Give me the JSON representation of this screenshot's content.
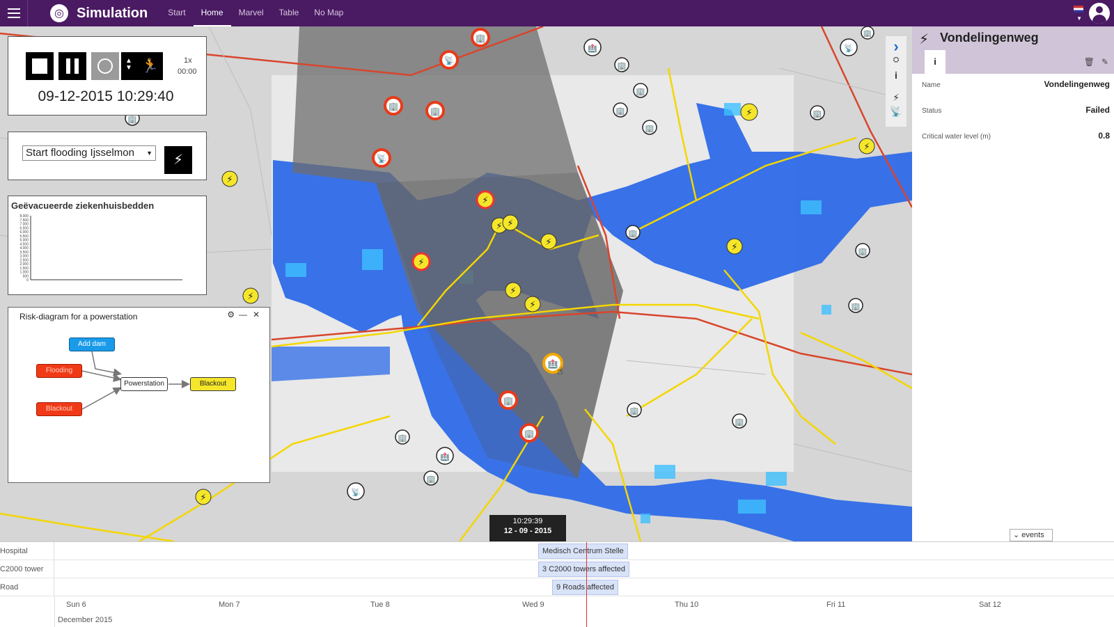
{
  "app": {
    "title": "Simulation"
  },
  "nav": {
    "tabs": [
      "Start",
      "Home",
      "Marvel",
      "Table",
      "No Map"
    ],
    "active": "Home"
  },
  "simulation": {
    "speed": "1x",
    "elapsed": "00:00",
    "datetime": "09-12-2015 10:29:40"
  },
  "scenario": {
    "selected": "Start flooding Ijsselmon"
  },
  "chart": {
    "title": "Geëvacueerde ziekenhuisbedden",
    "yticks": [
      "8.000",
      "7.500",
      "7.000",
      "6.500",
      "6.000",
      "5.500",
      "5.000",
      "4.500",
      "4.000",
      "3.500",
      "3.000",
      "2.500",
      "2.000",
      "1.500",
      "1.000",
      "500",
      "0"
    ]
  },
  "chart_data": {
    "type": "line",
    "title": "Geëvacueerde ziekenhuisbedden",
    "ylim": [
      0,
      8000
    ],
    "series": [
      {
        "values": []
      }
    ]
  },
  "risk": {
    "title": "Risk-diagram for a powerstation",
    "nodes": {
      "add_dam": "Add dam",
      "flooding": "Flooding",
      "blackout_left": "Blackout",
      "powerstation": "Powerstation",
      "blackout": "Blackout"
    }
  },
  "detail": {
    "title": "Vondelingenweg",
    "rows": [
      {
        "key": "Name",
        "value": "Vondelingenweg"
      },
      {
        "key": "Status",
        "value": "Failed"
      },
      {
        "key": "Critical water level (m)",
        "value": "0.8"
      }
    ]
  },
  "timeline": {
    "tooltip_time": "10:29:39",
    "tooltip_date": "12 - 09 - 2015",
    "events_button": "events",
    "rows": [
      {
        "label": "Hospital",
        "event": "Medisch Centrum Stelle"
      },
      {
        "label": "C2000 tower",
        "event": "3 C2000 towers affected"
      },
      {
        "label": "Road",
        "event": "9 Roads affected"
      }
    ],
    "days": [
      "Sun 6",
      "Mon 7",
      "Tue 8",
      "Wed 9",
      "Thu 10",
      "Fri 11",
      "Sat 12"
    ],
    "month": "December 2015"
  },
  "colors": {
    "topbar": "#4a1a63",
    "flood": "#2f6be8",
    "highlight": "#6e6e6e"
  }
}
